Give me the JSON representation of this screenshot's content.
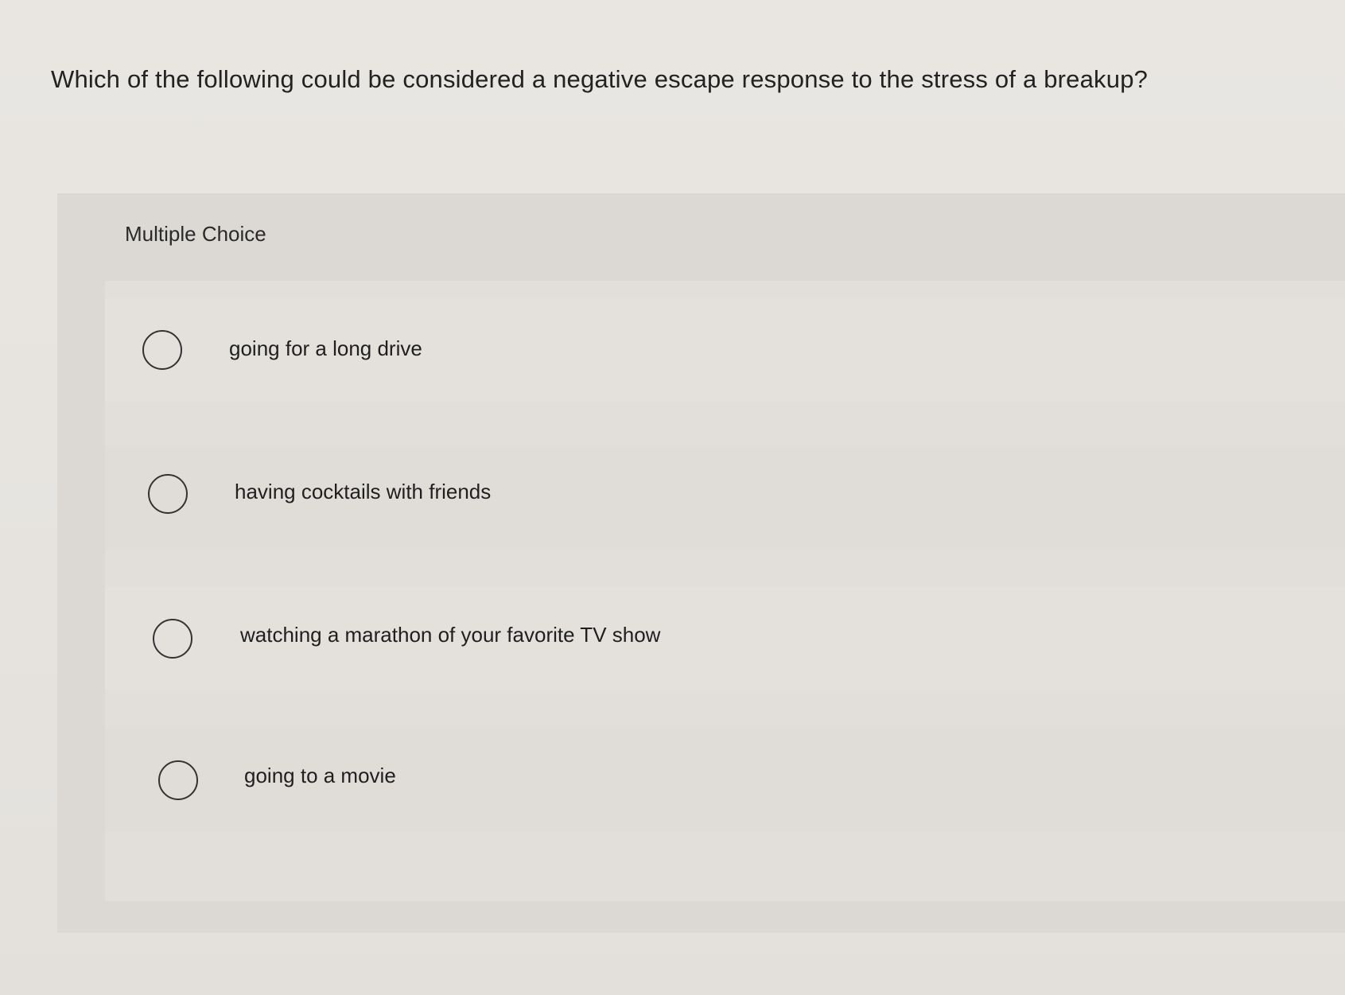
{
  "question": {
    "text": "Which of the following could be considered a negative escape response to the stress of a breakup?"
  },
  "choices": {
    "heading": "Multiple Choice",
    "options": [
      {
        "label": "going for a long drive"
      },
      {
        "label": "having cocktails with friends"
      },
      {
        "label": "watching a marathon of your favorite TV show"
      },
      {
        "label": "going to a movie"
      }
    ]
  }
}
